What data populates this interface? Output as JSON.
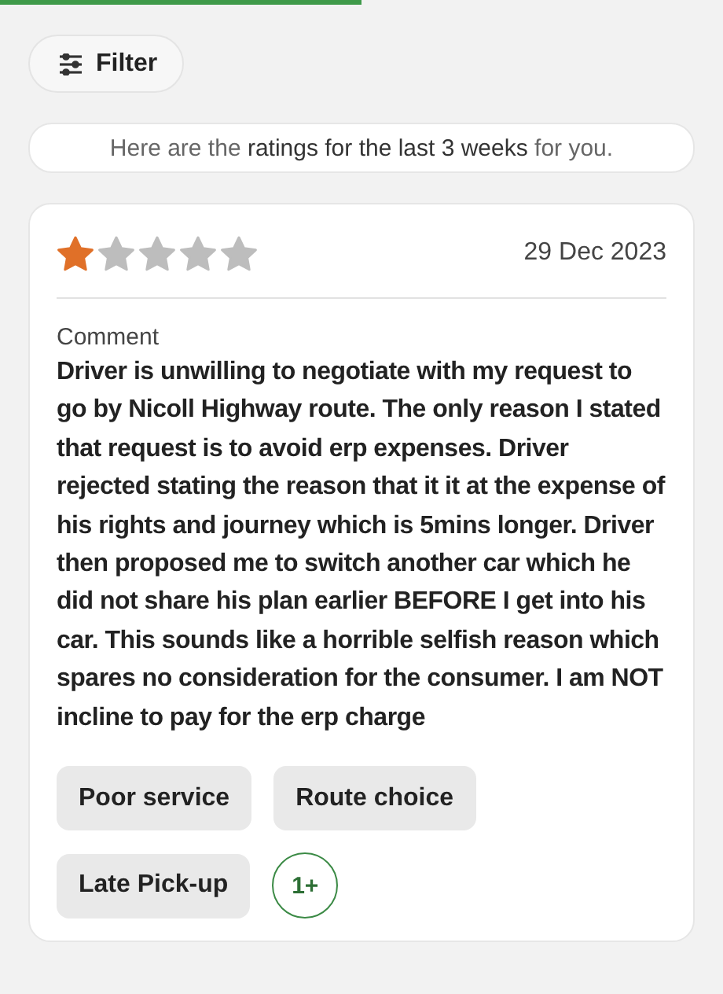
{
  "progress": {
    "level": 0.5
  },
  "filter_button": {
    "label": "Filter"
  },
  "info_banner": "Here are the **ratings for the last 3 weeks** for you.",
  "review": {
    "stars": 1,
    "date": "29 Dec 2023",
    "comment_label": "Comment",
    "comment": "Driver is unwilling to negotiate with my request to go by Nicoll Highway route. The only reason I stated that request is to avoid erp expenses. Driver rejected stating the reason that it it at the expense of his rights and journey which is 5mins longer. Driver then proposed me to switch another car which he did not share his plan earlier BEFORE I get into his car. This sounds like a horrible selfish reason which spares no consideration for the consumer. I am NOT incline to pay for the erp charge",
    "tags": [
      "Poor service",
      "Route choice",
      "Late Pick-up"
    ],
    "more_tags": "1+"
  }
}
